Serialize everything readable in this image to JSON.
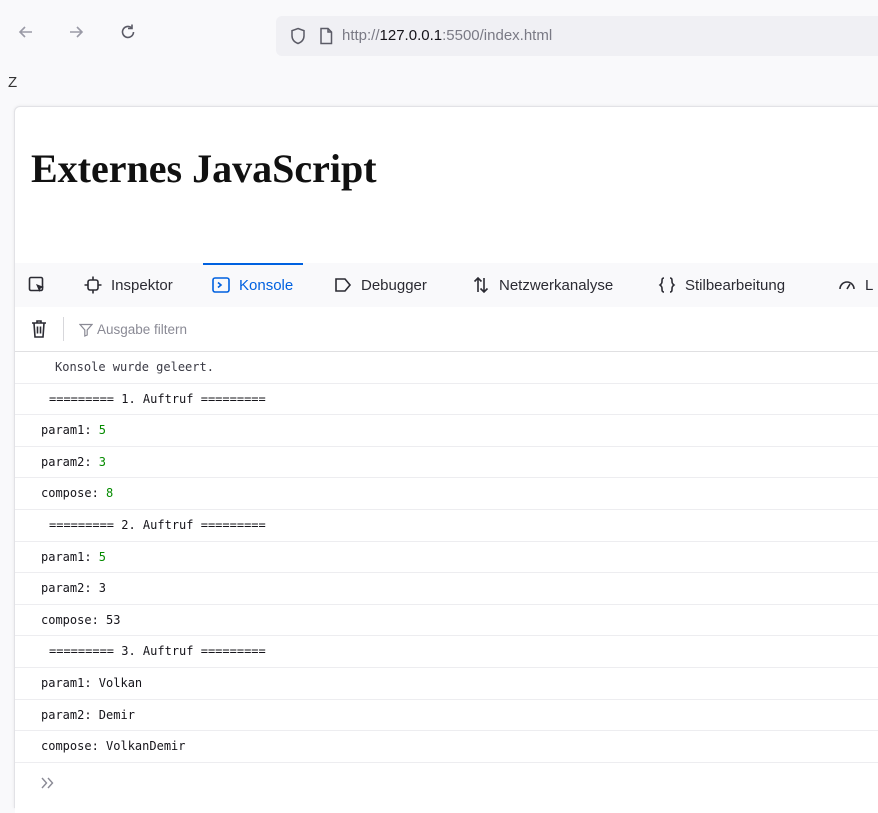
{
  "browser": {
    "url_prefix": "http://",
    "url_host": "127.0.0.1",
    "url_rest": ":5500/index.html"
  },
  "stray_text": "Z",
  "page": {
    "heading": "Externes JavaScript"
  },
  "devtools": {
    "tabs": [
      {
        "label": "Inspektor",
        "icon": "inspector-icon"
      },
      {
        "label": "Konsole",
        "icon": "console-icon",
        "active": true
      },
      {
        "label": "Debugger",
        "icon": "debugger-icon"
      },
      {
        "label": "Netzwerkanalyse",
        "icon": "network-icon"
      },
      {
        "label": "Stilbearbeitung",
        "icon": "style-editor-icon"
      },
      {
        "label": "L",
        "icon": "performance-icon"
      }
    ],
    "filter_placeholder": "Ausgabe filtern",
    "console_rows": [
      {
        "text": "Konsole wurde geleert.",
        "kind": "cleared"
      },
      {
        "text": "========= 1. Auftruf =========",
        "kind": "sep"
      },
      {
        "label": "param1: ",
        "value": "5",
        "numeric": true
      },
      {
        "label": "param2: ",
        "value": "3",
        "numeric": true
      },
      {
        "label": "compose: ",
        "value": "8",
        "numeric": true
      },
      {
        "text": "========= 2. Auftruf =========",
        "kind": "sep"
      },
      {
        "label": "param1: ",
        "value": "5",
        "numeric": true
      },
      {
        "label": "param2: ",
        "value": "3",
        "numeric": false
      },
      {
        "label": "compose: ",
        "value": "53",
        "numeric": false
      },
      {
        "text": "========= 3. Auftruf =========",
        "kind": "sep"
      },
      {
        "label": "param1: ",
        "value": "Volkan",
        "numeric": false
      },
      {
        "label": "param2: ",
        "value": "Demir",
        "numeric": false
      },
      {
        "label": "compose: ",
        "value": "VolkanDemir",
        "numeric": false
      }
    ]
  },
  "colors": {
    "accent": "#0061e0",
    "number": "#058b00"
  }
}
